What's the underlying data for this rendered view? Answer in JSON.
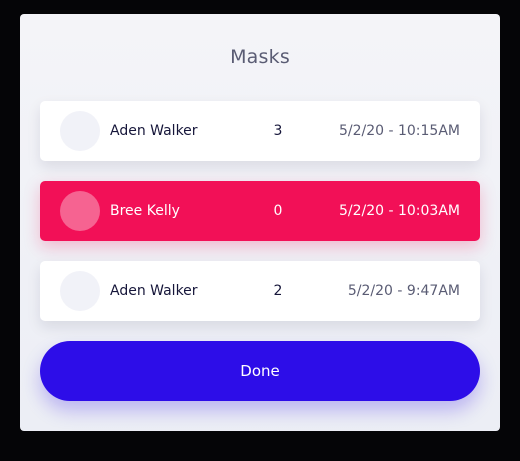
{
  "modal": {
    "title": "Masks",
    "rows": [
      {
        "name": "Aden Walker",
        "count": "3",
        "date": "5/2/20 - 10:15AM"
      },
      {
        "name": "Bree Kelly",
        "count": "0",
        "date": "5/2/20 - 10:03AM"
      },
      {
        "name": "Aden Walker",
        "count": "2",
        "date": "5/2/20 - 9:47AM"
      }
    ],
    "done_label": "Done"
  },
  "colors": {
    "selected_row": "#f21057",
    "primary_button": "#2d0de8",
    "text_dark": "#16163a",
    "text_muted": "#5a5c74"
  }
}
